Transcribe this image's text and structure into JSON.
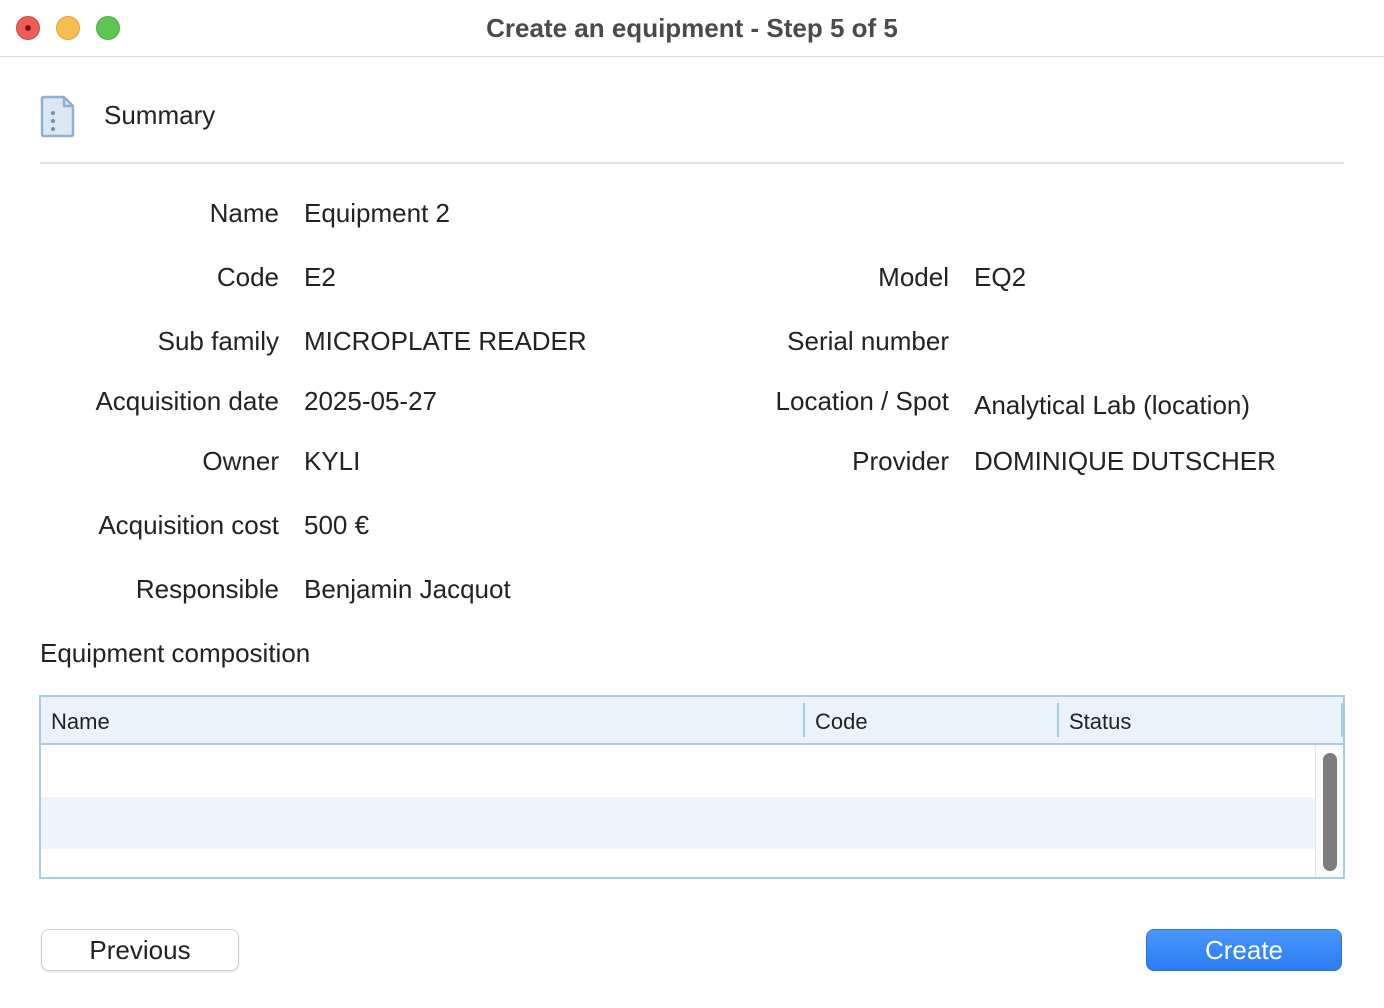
{
  "window": {
    "title": "Create an equipment - Step 5 of 5"
  },
  "section": {
    "title": "Summary",
    "icon": "document-icon"
  },
  "fields_left": [
    {
      "label": "Name",
      "value": "Equipment 2"
    },
    {
      "label": "Code",
      "value": "E2"
    },
    {
      "label": "Sub family",
      "value": "MICROPLATE READER"
    },
    {
      "label": "Acquisition date",
      "value": "2025-05-27"
    },
    {
      "label": "Owner",
      "value": "KYLI"
    },
    {
      "label": "Acquisition cost",
      "value": "500 €"
    },
    {
      "label": "Responsible",
      "value": "Benjamin Jacquot"
    }
  ],
  "fields_right": [
    {
      "label": "Model",
      "value": "EQ2"
    },
    {
      "label": "Serial number",
      "value": ""
    },
    {
      "label": "Location / Spot",
      "value": "Analytical Lab (location)"
    },
    {
      "label": "Provider",
      "value": "DOMINIQUE DUTSCHER"
    }
  ],
  "composition": {
    "title": "Equipment composition",
    "columns": [
      "Name",
      "Code",
      "Status"
    ],
    "rows": []
  },
  "buttons": {
    "previous": "Previous",
    "create": "Create"
  },
  "colors": {
    "accent": "#2b7cf0",
    "table_border": "#a9cce3",
    "header_bg": "#eaf3fc"
  }
}
